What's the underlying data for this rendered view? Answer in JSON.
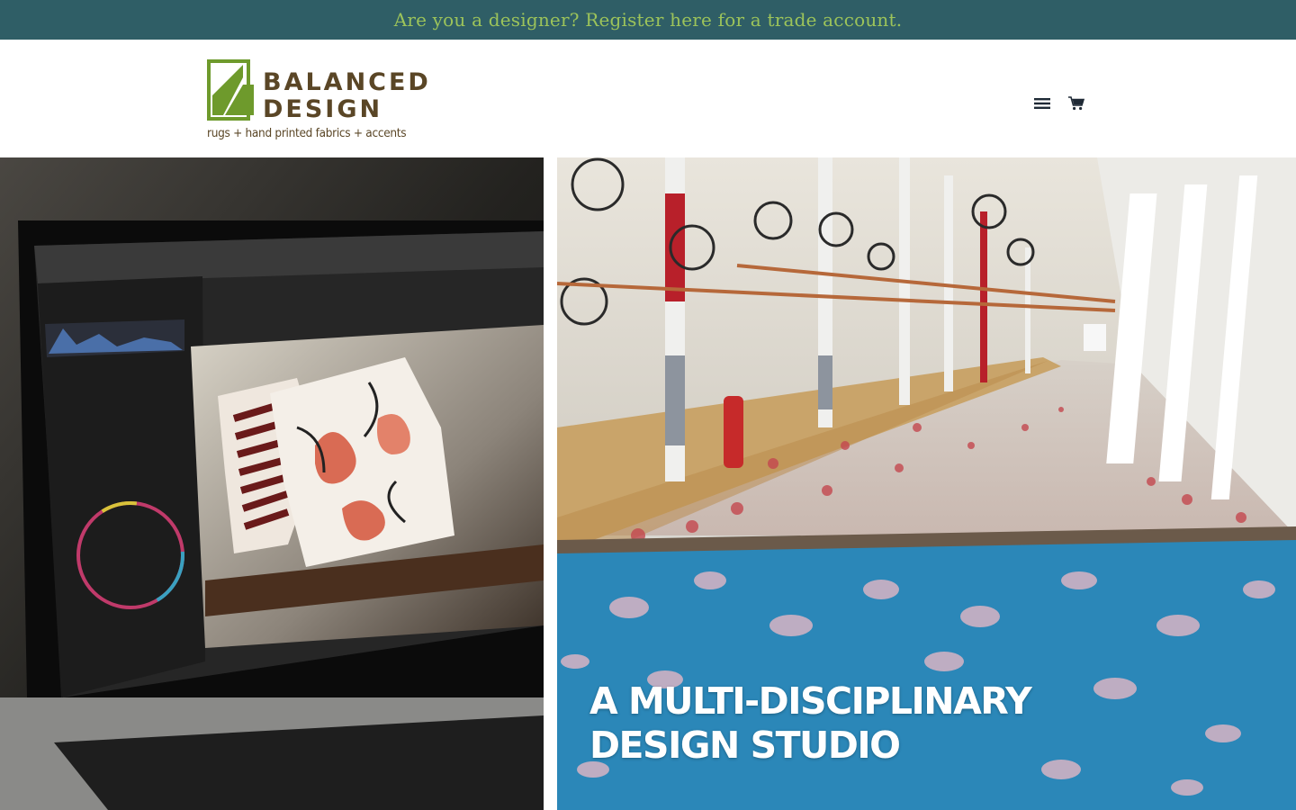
{
  "announcement": {
    "text": "Are you a designer? Register here for a trade account."
  },
  "logo": {
    "line1": "BALANCED",
    "line2": "DESIGN",
    "tagline": "rugs + hand printed fabrics + accents"
  },
  "nav": {
    "menu_icon": "hamburger-menu-icon",
    "cart_icon": "shopping-cart-icon"
  },
  "hero": {
    "left_image": "laptop photo-editing pillow product shot",
    "right_image": "textile print factory table",
    "caption_line1": "A MULTI-DISCIPLINARY",
    "caption_line2": "DESIGN STUDIO"
  },
  "colors": {
    "announcement_bg": "#2f5e66",
    "announcement_text": "#9cc35a",
    "logo_green": "#6e9a2c",
    "logo_brown": "#5a4626"
  }
}
